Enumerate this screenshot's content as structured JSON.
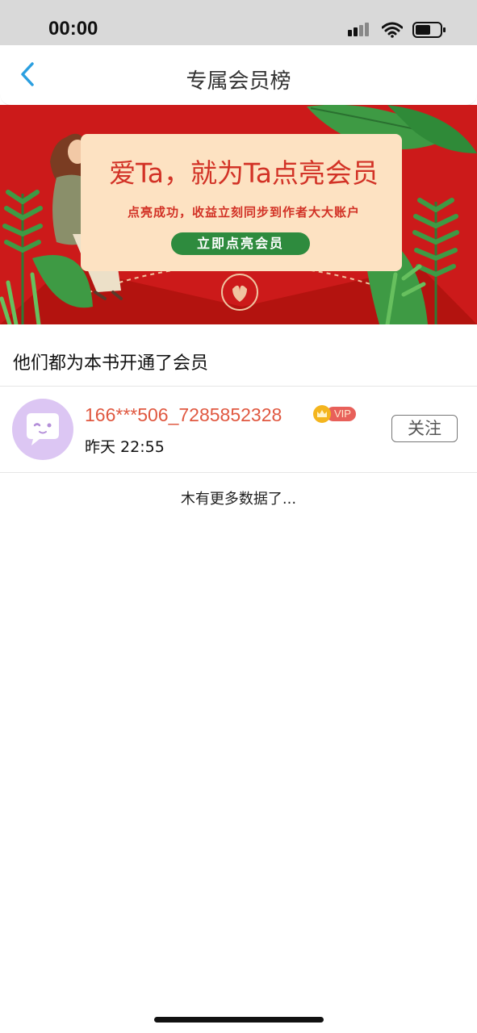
{
  "status_bar": {
    "time": "00:00",
    "icons": [
      "signal-icon",
      "wifi-icon",
      "battery-icon"
    ]
  },
  "nav": {
    "back_icon": "chevron-left-icon",
    "title": "专属会员榜"
  },
  "banner": {
    "headline": "爱Ta，就为Ta点亮会员",
    "subtitle": "点亮成功，收益立刻同步到作者大大账户",
    "cta_label": "立即点亮会员"
  },
  "section": {
    "title": "他们都为本书开通了会员"
  },
  "members": [
    {
      "name": "166***506_7285852328",
      "badge": "VIP",
      "time": "昨天 22:55",
      "follow_label": "关注"
    }
  ],
  "list_footer": "木有更多数据了...",
  "colors": {
    "accent_blue": "#2b9fe0",
    "banner_red": "#cc1a1a",
    "name_red": "#e05840",
    "avatar_purple": "#dcc6f3"
  }
}
